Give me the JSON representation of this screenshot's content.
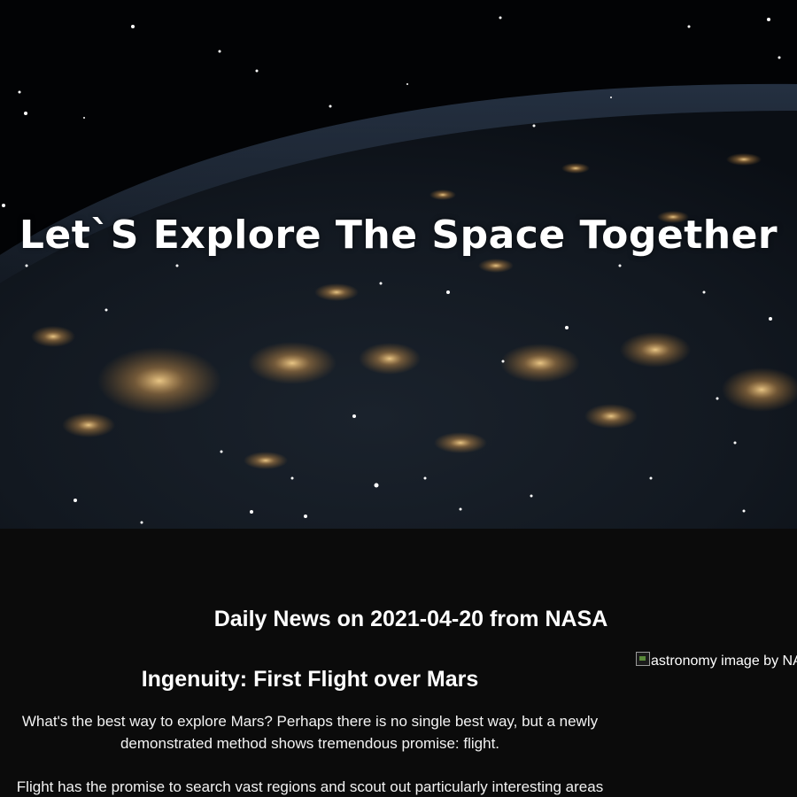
{
  "hero": {
    "title": "Let`S Explore The Space Together"
  },
  "news": {
    "heading": "Daily News on 2021-04-20 from NASA",
    "article": {
      "title": "Ingenuity: First Flight over Mars",
      "paragraphs": [
        "What's the best way to explore Mars? Perhaps there is no single best way, but a newly demonstrated method shows tremendous promise: flight.",
        "Flight has the promise to search vast regions and scout out particularly interesting areas"
      ]
    },
    "image": {
      "alt": "astronomy image by NASA"
    }
  },
  "colors": {
    "background": "#0b0b0b",
    "text": "#ffffff",
    "city_lights": "#f0b060"
  }
}
